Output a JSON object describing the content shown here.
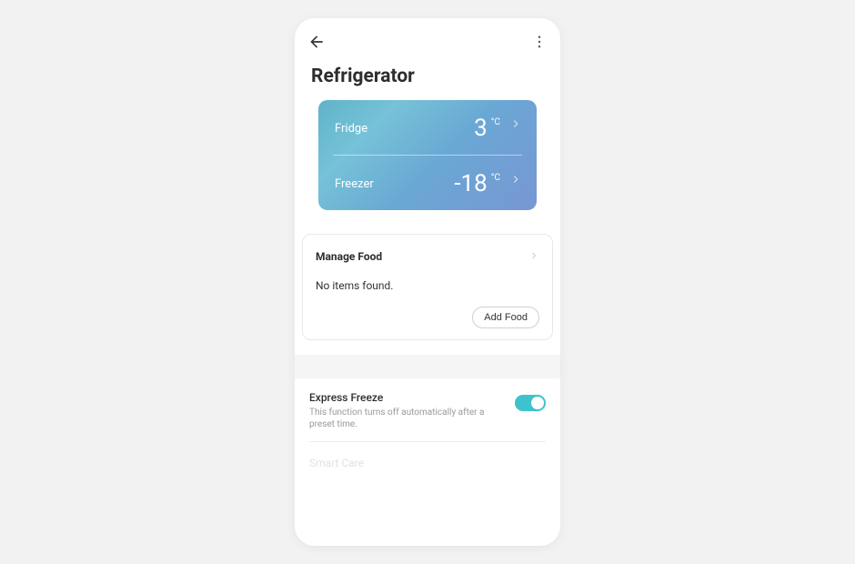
{
  "page_title": "Refrigerator",
  "temperature_card": {
    "rows": [
      {
        "label": "Fridge",
        "value": "3",
        "unit": "°C"
      },
      {
        "label": "Freezer",
        "value": "-18",
        "unit": "°C"
      }
    ]
  },
  "manage_food": {
    "title": "Manage Food",
    "empty_text": "No items found.",
    "add_button": "Add Food"
  },
  "settings": {
    "express_freeze": {
      "title": "Express Freeze",
      "description": "This function turns off automatically after a preset time.",
      "enabled": true
    },
    "smart_care": {
      "title": "Smart Care"
    }
  },
  "colors": {
    "accent": "#3ec3cc"
  }
}
